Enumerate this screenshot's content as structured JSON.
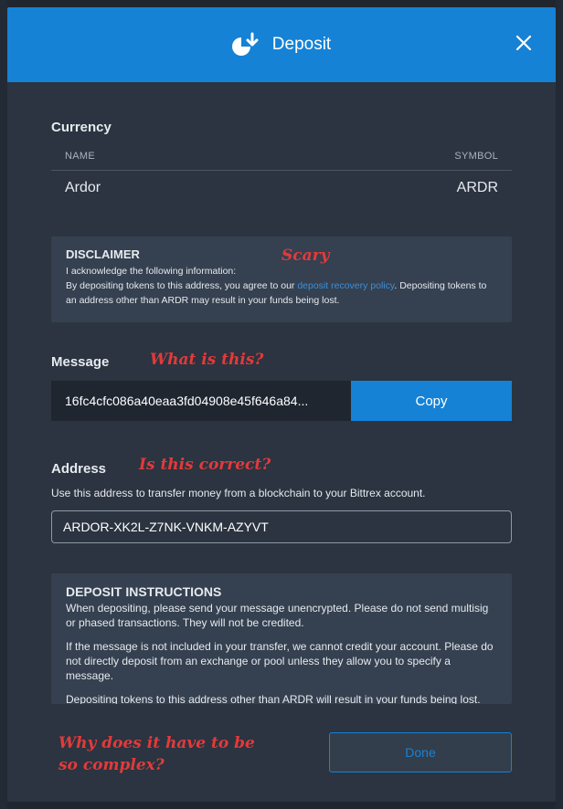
{
  "header": {
    "title": "Deposit",
    "accent_color": "#1582d6"
  },
  "currency": {
    "label": "Currency",
    "col_name": "NAME",
    "col_symbol": "SYMBOL",
    "name": "Ardor",
    "symbol": "ARDR"
  },
  "disclaimer": {
    "title": "DISCLAIMER",
    "line1": "I acknowledge the following information:",
    "text_before_link": "By depositing tokens to this address, you agree to our ",
    "link_text": "deposit recovery policy",
    "text_after_link": ". Depositing tokens to an address other than ARDR may result in your funds being lost."
  },
  "annotations": {
    "disclaimer_note": "Scary",
    "message_note": "What is this?",
    "address_note": "Is this correct?",
    "footer_note": "Why does it have to be so complex?"
  },
  "message": {
    "label": "Message",
    "value": "16fc4cfc086a40eaa3fd04908e45f646a84...",
    "copy_label": "Copy"
  },
  "address": {
    "label": "Address",
    "help": "Use this address to transfer money from a blockchain to your Bittrex account.",
    "value": "ARDOR-XK2L-Z7NK-VNKM-AZYVT"
  },
  "instructions": {
    "title": "DEPOSIT INSTRUCTIONS",
    "p1": "When depositing, please send your message unencrypted. Please do not send multisig or phased transactions. They will not be credited.",
    "p2": "If the message is not included in your transfer, we cannot credit your account. Please do not directly deposit from an exchange or pool unless they allow you to specify a message.",
    "p3": "Depositing tokens to this address other than ARDR will result in your funds being lost."
  },
  "footer": {
    "done_label": "Done"
  }
}
